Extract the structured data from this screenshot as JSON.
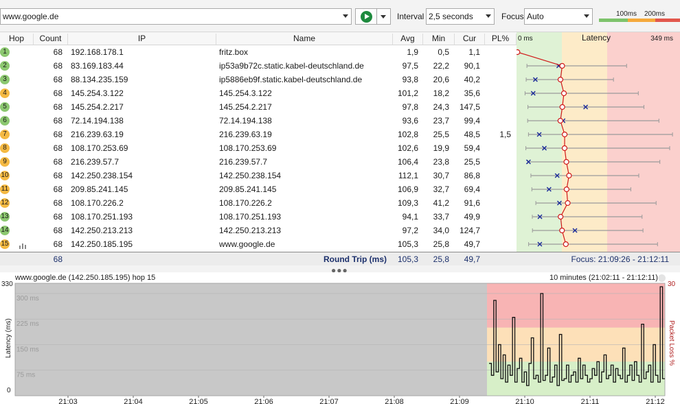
{
  "toolbar": {
    "target": "www.google.de",
    "interval_label": "Interval",
    "interval_value": "2,5 seconds",
    "focus_label": "Focus",
    "focus_value": "Auto",
    "scale_100": "100ms",
    "scale_200": "200ms",
    "scale_colors": [
      "#7dc36b",
      "#f5a93b",
      "#e2574c"
    ]
  },
  "columns": {
    "hop": "Hop",
    "count": "Count",
    "ip": "IP",
    "name": "Name",
    "avg": "Avg",
    "min": "Min",
    "cur": "Cur",
    "pl": "PL%",
    "lat_min": "0 ms",
    "latency": "Latency",
    "lat_max": "349 ms"
  },
  "colors": {
    "good": "#dff2d5",
    "warn": "#fdebc8",
    "bad": "#fbd0cd",
    "badge_green": "#8cc870",
    "badge_orange": "#f5b942",
    "line": "#d01818",
    "cur_marker": "#1a2a9a"
  },
  "hops": [
    {
      "hop": "1",
      "count": "68",
      "ip": "192.168.178.1",
      "name": "fritz.box",
      "avg": "1,9",
      "min": "0,5",
      "cur": "1,1",
      "pl": "",
      "badge": "green",
      "max_ms": 3
    },
    {
      "hop": "2",
      "count": "68",
      "ip": "83.169.183.44",
      "name": "ip53a9b72c.static.kabel-deutschland.de",
      "avg": "97,5",
      "min": "22,2",
      "cur": "90,1",
      "pl": "",
      "badge": "green",
      "max_ms": 235
    },
    {
      "hop": "3",
      "count": "68",
      "ip": "88.134.235.159",
      "name": "ip5886eb9f.static.kabel-deutschland.de",
      "avg": "93,8",
      "min": "20,6",
      "cur": "40,2",
      "pl": "",
      "badge": "green",
      "max_ms": 207
    },
    {
      "hop": "4",
      "count": "68",
      "ip": "145.254.3.122",
      "name": "145.254.3.122",
      "avg": "101,2",
      "min": "18,2",
      "cur": "35,6",
      "pl": "",
      "badge": "orange",
      "max_ms": 260
    },
    {
      "hop": "5",
      "count": "68",
      "ip": "145.254.2.217",
      "name": "145.254.2.217",
      "avg": "97,8",
      "min": "24,3",
      "cur": "147,5",
      "pl": "",
      "badge": "green",
      "max_ms": 272
    },
    {
      "hop": "6",
      "count": "68",
      "ip": "72.14.194.138",
      "name": "72.14.194.138",
      "avg": "93,6",
      "min": "23,7",
      "cur": "99,4",
      "pl": "",
      "badge": "green",
      "max_ms": 304
    },
    {
      "hop": "7",
      "count": "68",
      "ip": "216.239.63.19",
      "name": "216.239.63.19",
      "avg": "102,8",
      "min": "25,5",
      "cur": "48,5",
      "pl": "1,5",
      "badge": "orange",
      "max_ms": 333
    },
    {
      "hop": "8",
      "count": "68",
      "ip": "108.170.253.69",
      "name": "108.170.253.69",
      "avg": "102,6",
      "min": "19,9",
      "cur": "59,4",
      "pl": "",
      "badge": "orange",
      "max_ms": 327
    },
    {
      "hop": "9",
      "count": "68",
      "ip": "216.239.57.7",
      "name": "216.239.57.7",
      "avg": "106,4",
      "min": "23,8",
      "cur": "25,5",
      "pl": "",
      "badge": "orange",
      "max_ms": 306
    },
    {
      "hop": "10",
      "count": "68",
      "ip": "142.250.238.154",
      "name": "142.250.238.154",
      "avg": "112,1",
      "min": "30,7",
      "cur": "86,8",
      "pl": "",
      "badge": "orange",
      "max_ms": 261
    },
    {
      "hop": "11",
      "count": "68",
      "ip": "209.85.241.145",
      "name": "209.85.241.145",
      "avg": "106,9",
      "min": "32,7",
      "cur": "69,4",
      "pl": "",
      "badge": "orange",
      "max_ms": 244
    },
    {
      "hop": "12",
      "count": "68",
      "ip": "108.170.226.2",
      "name": "108.170.226.2",
      "avg": "109,3",
      "min": "41,2",
      "cur": "91,6",
      "pl": "",
      "badge": "orange",
      "max_ms": 298
    },
    {
      "hop": "13",
      "count": "68",
      "ip": "108.170.251.193",
      "name": "108.170.251.193",
      "avg": "94,1",
      "min": "33,7",
      "cur": "49,9",
      "pl": "",
      "badge": "green",
      "max_ms": 268
    },
    {
      "hop": "14",
      "count": "68",
      "ip": "142.250.213.213",
      "name": "142.250.213.213",
      "avg": "97,2",
      "min": "34,0",
      "cur": "124,7",
      "pl": "",
      "badge": "green",
      "max_ms": 270
    },
    {
      "hop": "15",
      "count": "68",
      "ip": "142.250.185.195",
      "name": "www.google.de",
      "avg": "105,3",
      "min": "25,8",
      "cur": "49,7",
      "pl": "",
      "badge": "orange",
      "max_ms": 301
    }
  ],
  "summary": {
    "count": "68",
    "label": "Round Trip (ms)",
    "avg": "105,3",
    "min": "25,8",
    "cur": "49,7",
    "focus": "Focus: 21:09:26 - 21:12:11"
  },
  "history": {
    "title": "www.google.de (142.250.185.195) hop 15",
    "range": "10 minutes (21:02:11 - 21:12:11)",
    "y_axis_label": "Latency (ms)",
    "y2_axis_label": "Packet Loss %",
    "y_top": "330",
    "y_bottom": "0",
    "y2_top": "30",
    "grid_labels": [
      "300 ms",
      "225 ms",
      "150 ms",
      "75 ms"
    ],
    "time_ticks": [
      "21:03",
      "21:04",
      "21:05",
      "21:06",
      "21:07",
      "21:08",
      "21:09",
      "21:10",
      "21:11",
      "21:12"
    ],
    "chart_data": {
      "type": "line",
      "xlabel": "",
      "ylabel": "Latency (ms)",
      "ylim": [
        0,
        330
      ],
      "no_data_until": "21:09:26",
      "series": [
        {
          "values": [
            95,
            60,
            280,
            70,
            150,
            50,
            120,
            40,
            90,
            60,
            230,
            40,
            80,
            110,
            40,
            70,
            30,
            95,
            170,
            50,
            60,
            40,
            300,
            45,
            60,
            140,
            40,
            55,
            90,
            30,
            180,
            45,
            50,
            90,
            40,
            60,
            70,
            40,
            110,
            50,
            90,
            60,
            40,
            50,
            80,
            60,
            100,
            40,
            70,
            120,
            50,
            60,
            90,
            40,
            80,
            60,
            50,
            140,
            40,
            60,
            90,
            45,
            100,
            60,
            40,
            210,
            50,
            70,
            90,
            40,
            150,
            60,
            40,
            320,
            50
          ]
        }
      ]
    }
  }
}
